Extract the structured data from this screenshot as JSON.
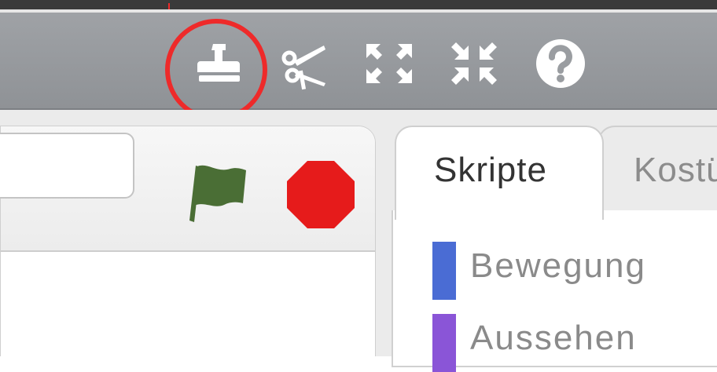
{
  "toolbar": {
    "tools": [
      {
        "name": "stamp",
        "icon": "stamp-icon",
        "highlighted": true
      },
      {
        "name": "scissors",
        "icon": "scissors-icon"
      },
      {
        "name": "grow",
        "icon": "grow-icon"
      },
      {
        "name": "shrink",
        "icon": "shrink-icon"
      },
      {
        "name": "help",
        "icon": "help-icon"
      }
    ],
    "highlight_color": "#ee2a2a"
  },
  "stage": {
    "project_title_value": "",
    "green_flag_color": "#4a6e35",
    "stop_color": "#e61b1b"
  },
  "tabs": [
    {
      "label": "Skripte",
      "active": true
    },
    {
      "label": "Kostüme",
      "active": false
    }
  ],
  "categories": [
    {
      "label": "Bewegung",
      "color": "#4a6cd4"
    },
    {
      "label": "Aussehen",
      "color": "#8a55d7"
    }
  ]
}
